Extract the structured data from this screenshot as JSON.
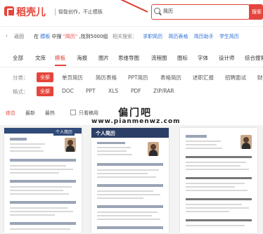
{
  "brand": {
    "logo_text": "稻壳儿",
    "slogan": "智能创作，不止模板"
  },
  "search": {
    "value": "简历",
    "button_label": "搜索"
  },
  "result": {
    "back_label": "返回",
    "prefix": "在",
    "category": "模板",
    "middle": "中搜",
    "query": "\"简历\"",
    "suffix": ",找到5000组",
    "related_label": "相关搜索：",
    "related": [
      "求职简历",
      "简历表格",
      "简历助手",
      "学生简历"
    ]
  },
  "categories": {
    "items": [
      "全部",
      "文库",
      "模板",
      "海报",
      "图片",
      "思维导图",
      "流程图",
      "图标",
      "字体",
      "设计师",
      "综合搜索"
    ],
    "active": "模板"
  },
  "filters": {
    "class_label": "分类：",
    "class_options": [
      "全部",
      "单页简历",
      "简历表格",
      "PPT简历",
      "表格简历",
      "述职汇报",
      "招聘面试",
      "财"
    ],
    "format_label": "格式：",
    "format_options": [
      "全部",
      "DOC",
      "PPT",
      "XLS",
      "PDF",
      "ZIP/RAR"
    ]
  },
  "sort": {
    "options": [
      "综合",
      "最新",
      "最热"
    ],
    "active": "综合",
    "checkbox_label": "只看稿用"
  },
  "watermark": {
    "title": "偏门吧",
    "url": "www.pianmenwz.com"
  },
  "templates": [
    {
      "badge": "个人简历",
      "title": "",
      "color": "#2f4a78"
    },
    {
      "badge": "",
      "title": "个人简历",
      "color": "#2b3f66"
    },
    {
      "badge": "",
      "title": "",
      "color": "#555555"
    }
  ],
  "colors": {
    "brand": "#e5453c",
    "link": "#2a6fd6"
  }
}
